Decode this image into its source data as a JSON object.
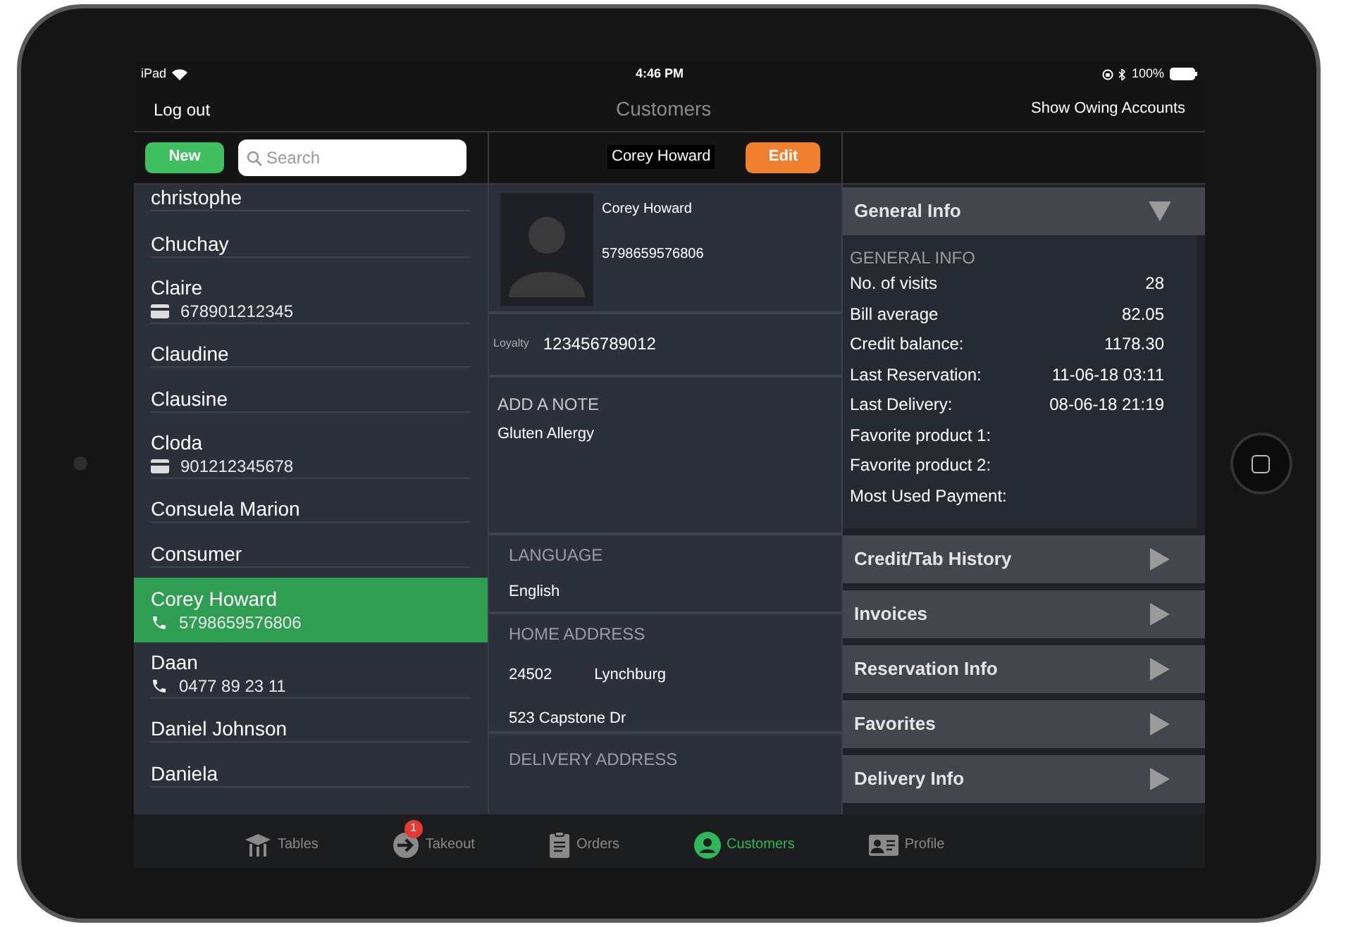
{
  "status_bar": {
    "device": "iPad",
    "time": "4:46 PM",
    "battery": "100%"
  },
  "nav": {
    "left": "Log out",
    "title": "Customers",
    "right": "Show Owing Accounts"
  },
  "toolbar": {
    "new_button": "New",
    "search": {
      "placeholder": "Search"
    },
    "customer_name": "Corey Howard",
    "edit_button": "Edit"
  },
  "customers": [
    {
      "name": "christophe",
      "selected": false
    },
    {
      "name": "Chuchay",
      "selected": false
    },
    {
      "name": "Claire",
      "kind": "card",
      "detail": "678901212345",
      "selected": false
    },
    {
      "name": "Claudine",
      "selected": false
    },
    {
      "name": "Clausine",
      "selected": false
    },
    {
      "name": "Cloda",
      "kind": "card",
      "detail": "901212345678",
      "selected": false
    },
    {
      "name": "Consuela Marion",
      "selected": false
    },
    {
      "name": "Consumer",
      "selected": false
    },
    {
      "name": "Corey Howard",
      "kind": "phone",
      "detail": "5798659576806",
      "selected": true
    },
    {
      "name": "Daan",
      "kind": "phone",
      "detail": "0477 89 23 11",
      "selected": false
    },
    {
      "name": "Daniel Johnson",
      "selected": false
    },
    {
      "name": "Daniela",
      "selected": false
    }
  ],
  "profile": {
    "name": "Corey Howard",
    "phone": "5798659576806",
    "loyalty_label": "Loyalty",
    "loyalty": "123456789012",
    "note_heading": "ADD A NOTE",
    "note": "Gluten Allergy",
    "language_heading": "LANGUAGE",
    "language": "English",
    "home_heading": "HOME ADDRESS",
    "zip": "24502",
    "city": "Lynchburg",
    "street": "523 Capstone Dr",
    "delivery_heading": "DELIVERY ADDRESS"
  },
  "sections": [
    {
      "title": "General Info",
      "expanded": true,
      "heading": "GENERAL INFO",
      "rows": [
        {
          "label": "No. of visits",
          "value": "28"
        },
        {
          "label": "Bill average",
          "value": "82.05"
        },
        {
          "label": "Credit balance:",
          "value": "1178.30"
        },
        {
          "label": "Last Reservation:",
          "value": "11-06-18 03:11"
        },
        {
          "label": "Last Delivery:",
          "value": "08-06-18 21:19"
        },
        {
          "label": "Favorite product 1:"
        },
        {
          "label": "Favorite product 2:"
        },
        {
          "label": "Most Used Payment:"
        }
      ]
    },
    {
      "title": "Credit/Tab History",
      "expanded": false
    },
    {
      "title": "Invoices",
      "expanded": false
    },
    {
      "title": "Reservation Info",
      "expanded": false
    },
    {
      "title": "Favorites",
      "expanded": false
    },
    {
      "title": "Delivery Info",
      "expanded": false
    }
  ],
  "tab_bar": [
    {
      "label": "Tables",
      "selected": false
    },
    {
      "label": "Takeout",
      "selected": false,
      "badge": "1"
    },
    {
      "label": "Orders",
      "selected": false
    },
    {
      "label": "Customers",
      "selected": true
    },
    {
      "label": "Profile",
      "selected": false
    }
  ]
}
